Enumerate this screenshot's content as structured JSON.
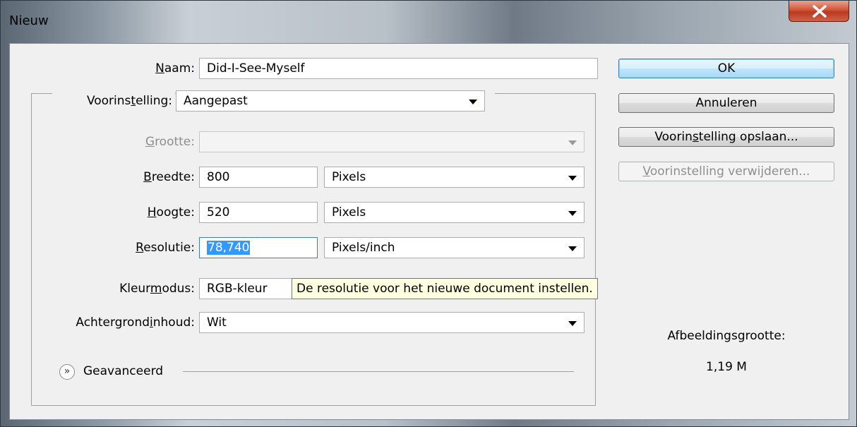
{
  "window": {
    "title": "Nieuw"
  },
  "form": {
    "name": {
      "label_pre": "",
      "label_u": "N",
      "label_post": "aam:",
      "value": "Did-I-See-Myself"
    },
    "preset": {
      "label_pre": "Voorins",
      "label_u": "t",
      "label_post": "elling:",
      "value": "Aangepast"
    },
    "size": {
      "label_pre": "",
      "label_u": "G",
      "label_post": "rootte:",
      "value": ""
    },
    "width": {
      "label_pre": "",
      "label_u": "B",
      "label_post": "reedte:",
      "value": "800",
      "unit": "Pixels"
    },
    "height": {
      "label_pre": "",
      "label_u": "H",
      "label_post": "oogte:",
      "value": "520",
      "unit": "Pixels"
    },
    "resolution": {
      "label_pre": "",
      "label_u": "R",
      "label_post": "esolutie:",
      "value": "78,740",
      "unit": "Pixels/inch"
    },
    "color_mode": {
      "label_pre": "Kleur",
      "label_u": "m",
      "label_post": "odus:",
      "value": "RGB-kleur"
    },
    "background": {
      "label_pre": "Achtergrond",
      "label_u": "i",
      "label_post": "nhoud:",
      "value": "Wit"
    },
    "advanced": {
      "label": "Geavanceerd"
    }
  },
  "tooltip": {
    "text": "De resolutie voor het nieuwe document instellen."
  },
  "buttons": {
    "ok": "OK",
    "cancel": "Annuleren",
    "save_pre": "Voorin",
    "save_u": "s",
    "save_post": "telling opslaan...",
    "delete_pre": "",
    "delete_u": "V",
    "delete_post": "oorinstelling verwijderen..."
  },
  "image_size": {
    "label": "Afbeeldingsgrootte:",
    "value": "1,19 M"
  },
  "icons": {
    "close": "close-icon",
    "dropdown": "chevron-down-icon",
    "advanced": "double-chevron-down-icon"
  }
}
